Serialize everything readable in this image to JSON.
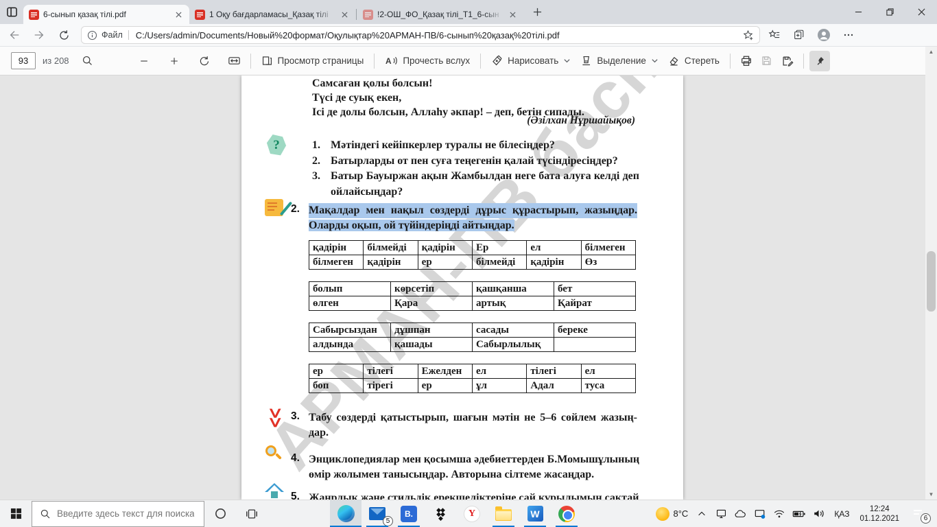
{
  "browser": {
    "tabs": [
      {
        "title": "6-сынып қазақ тілі.pdf"
      },
      {
        "title": "1 Оқу бағдарламасы_Қазақ тілі"
      },
      {
        "title": "!2-ОШ_ФО_Қазақ тілі_Т1_6-сын"
      }
    ],
    "nav": {
      "file_label": "Файл",
      "url": "C:/Users/admin/Documents/Новый%20формат/Оқулықтар%20АРМАН-ПВ/6-сынып%20қазақ%20тілі.pdf"
    }
  },
  "pdf_toolbar": {
    "page_number": "93",
    "of_pages": "из 208",
    "page_view": "Просмотр страницы",
    "read_aloud": "Прочесть вслух",
    "draw": "Нарисовать",
    "highlight": "Выделение",
    "erase": "Стереть"
  },
  "document": {
    "watermark": "АРМАН-ПВ баспасы",
    "poem": {
      "lines": [
        "Самсаған қолы болсын!",
        "Түсі де суық екен,",
        "Ісі де долы болсын, Аллаһу әкпар! – деп, бетін сипады."
      ],
      "author": "(Әзілхан Нұршайықов)"
    },
    "questions": {
      "numbers": [
        "1.",
        "2.",
        "3."
      ],
      "items": [
        "Мәтіндегі кейіпкерлер туралы не білесіңдер?",
        "Батырларды от пен суға теңегенін қалай түсіндіресіңдер?",
        "Батыр Бауыржан ақын Жамбылдан неге бата алуға келді деп ойлайсыңдар?"
      ]
    },
    "tasks": {
      "t2": {
        "num": "2.",
        "sel1": "Мақалдар мен нақыл сөздерді дұрыс құрастырып, жазыңдар.",
        "sel2": "Оларды оқып, ой түйіндеріңді айтыңдар."
      },
      "t3": {
        "num": "3.",
        "line1": "Табу сөздерді қатыстырып, шағын мәтін не 5–6 сөйлем жазың-",
        "line2": "дар."
      },
      "t4": {
        "num": "4.",
        "line1": "Энциклопедиялар мен қосымша әдебиеттерден Б.Момышұлының",
        "line2": "өмір жолымен танысыңдар. Авторына сілтеме жасаңдар."
      },
      "t5": {
        "num": "5.",
        "line1": "Жанрлық және стильдік ерекшеліктеріне сай құрылымын сақтай"
      }
    },
    "tables": [
      {
        "rows": [
          [
            "қадірін",
            "білмейді",
            "қадірін",
            "Ер",
            "ел",
            "білмеген"
          ],
          [
            "білмеген",
            "қадірін",
            "ер",
            "білмейді",
            "қадірін",
            "Өз"
          ]
        ]
      },
      {
        "rows": [
          [
            "болып",
            "көрсетіп",
            "қашқанша",
            "бет"
          ],
          [
            "өлген",
            "Қара",
            "артық",
            "Қайрат"
          ]
        ]
      },
      {
        "rows": [
          [
            "Сабырсыздан",
            "дұшпан",
            "сасады",
            "береке"
          ],
          [
            "алдында",
            "қашады",
            "Сабырлылық",
            ""
          ]
        ]
      },
      {
        "rows": [
          [
            "ер",
            "тілегі",
            "Ежелден",
            "ел",
            "тілегі",
            "ел"
          ],
          [
            "боп",
            "тірегі",
            "ер",
            "ұл",
            "Адал",
            "туса"
          ]
        ]
      }
    ]
  },
  "taskbar": {
    "search_placeholder": "Введите здесь текст для поиска",
    "mail_badge": "5",
    "b_app_label": "B.",
    "word_label": "W",
    "yandex_label": "Y",
    "chevrons_glyph": ">>"
  },
  "tray": {
    "temperature": "8°C",
    "language": "ҚАЗ",
    "time": "12:24",
    "date": "01.12.2021",
    "notification_count": "6"
  },
  "colors": {
    "selection": "#a9c8ec",
    "accent_blue": "#0078d4",
    "pdf_red": "#d93025"
  }
}
